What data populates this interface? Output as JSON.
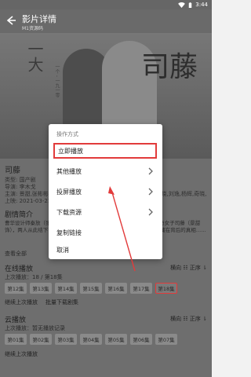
{
  "status_bar": {
    "time": "3:44"
  },
  "appbar": {
    "title": "影片详情",
    "subtitle": "M1资源码"
  },
  "poster": {
    "calli_main": "司藤",
    "calli_side": "一大",
    "side_text": "一个 - 一九一零"
  },
  "movie": {
    "title": "司藤",
    "type": "类型: 国产剧",
    "director": "导演: 李木戈",
    "cast": "主演: 景甜,张彬彬,李沐宸,朱晓,张哲,张棕杰,杜亚飞,李尔,陈贤,冯晓,刘逸,杨辉,奇晓,金玉,高正琰",
    "date": "上映: 2021-03-21"
  },
  "plot": {
    "title": "剧情简介",
    "desc": "曹华设计师秦放（张彬彬 饰）意外解救了被封印在地下沉睡数十年的奇女子司藤（景甜 饰），两人从此结下了不解之缘……一段关于妖族的秘密缓缓揭开，而藏在背后的真相……",
    "see_all": "查看全部"
  },
  "online": {
    "title": "在线播放",
    "view_toggle": "横向 ☷  正序 ⇂",
    "last_play": "上次播放：18 / 第18集",
    "episodes": [
      "第12集",
      "第13集",
      "第14集",
      "第15集",
      "第16集",
      "第17集",
      "第18集"
    ],
    "continue": "继续上次播放",
    "batch_download": "批量下载剧集"
  },
  "cloud": {
    "title": "云播放",
    "view_toggle": "横向 ☷  正序 ⇂",
    "last_play": "上次播放：暂无播放记录",
    "episodes": [
      "第01集",
      "第02集",
      "第03集",
      "第04集",
      "第05集",
      "第06集",
      "第07集"
    ],
    "continue": "继续上次播放"
  },
  "dialog": {
    "title": "操作方式",
    "items": [
      "立即播放",
      "其他播放",
      "投屏播放",
      "下载资源",
      "复制链接",
      "取消"
    ]
  },
  "colors": {
    "highlight_red": "#e23b3b",
    "dialog_bg": "#ffffff",
    "dim_bg": "#6e6e6e"
  }
}
